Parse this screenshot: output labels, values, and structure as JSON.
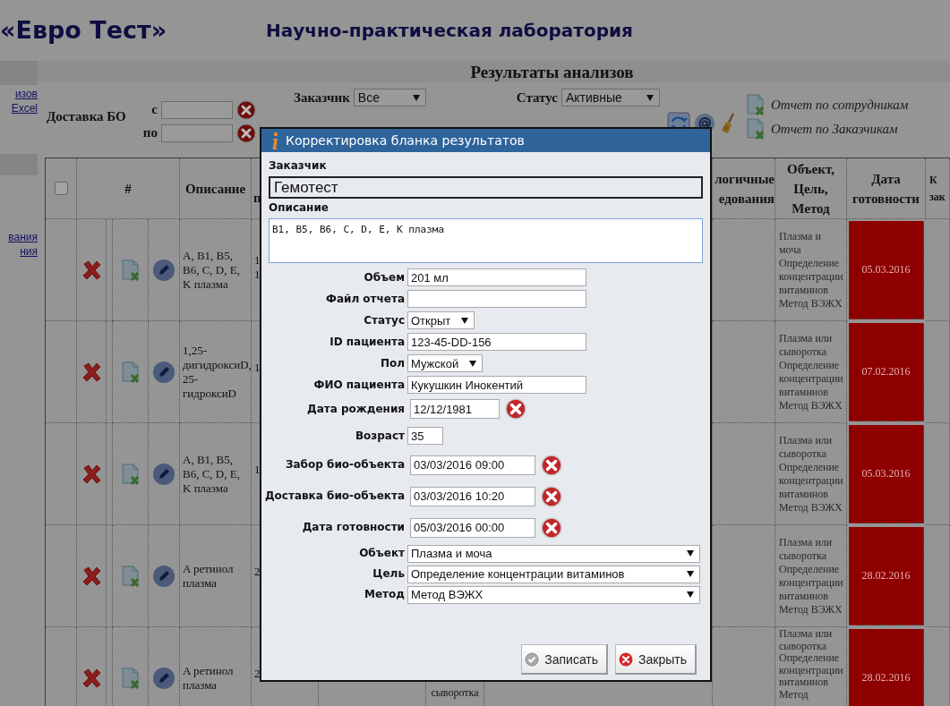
{
  "header": {
    "logo": "«Евро Тест»",
    "subtitle": "Научно-практическая лаборатория"
  },
  "sidebar": {
    "links_top": [
      "изов",
      "Excel"
    ],
    "links_bottom": [
      "вания",
      "ния"
    ]
  },
  "section_title": "Результаты анализов",
  "filters": {
    "delivery": {
      "label": "Доставка БО",
      "from_label": "с",
      "to_label": "по"
    },
    "customer": {
      "label": "Заказчик",
      "value": "Все"
    },
    "status": {
      "label": "Статус",
      "value": "Активные"
    },
    "reports": [
      "Отчет по сотрудникам",
      "Отчет по Заказчикам"
    ]
  },
  "table": {
    "select_all": {
      "checked": false
    },
    "columns": [
      "#",
      "Описание",
      "п",
      "логичные едования",
      "Объект, Цель, Метод",
      "Дата готовности",
      "К зак"
    ],
    "rows": [
      {
        "description": "A, B1, B5, B6, C, D, E, K плазма",
        "column_3": "1\n1",
        "column_4": "",
        "object_goal_method": "Плазма и моча Определение концентрации витаминов Метод ВЭЖХ",
        "ready_date": "05.03.2016",
        "overdue": true
      },
      {
        "description": "1,25-дигидроксиD, 25-гидроксиD",
        "column_3": "1",
        "column_4": "",
        "object_goal_method": "Плазма или сыворотка Определение концентрации витаминов Метод ВЭЖХ",
        "ready_date": "07.02.2016",
        "overdue": true
      },
      {
        "description": "A, B1, B5, B6, C, D, E, K плазма",
        "column_3": "1",
        "column_4": "",
        "object_goal_method": "Плазма или сыворотка Определение концентрации витаминов Метод ВЭЖХ",
        "ready_date": "05.03.2016",
        "overdue": true
      },
      {
        "description": "A ретинол плазма",
        "column_3": "2",
        "column_4": "",
        "object_goal_method": "Плазма или сыворотка Определение концентрации витаминов Метод ВЭЖХ",
        "ready_date": "28.02.2016",
        "overdue": true
      },
      {
        "description": "A ретинол плазма",
        "column_3": "2",
        "column_4": "сыворотка",
        "object_goal_method": "Плазма или сыворотка Определение концентрации витаминов Метод",
        "ready_date": "28.02.2016",
        "overdue": true
      }
    ]
  },
  "dialog": {
    "title": "Корректировка бланка результатов",
    "customer": {
      "label": "Заказчик",
      "value": "Гемотест"
    },
    "description": {
      "label": "Описание",
      "value": "B1, B5, B6, C, D, E, K плазма"
    },
    "fields": [
      {
        "label": "Объем",
        "kind": "text",
        "value": "201 мл"
      },
      {
        "label": "Файл отчета",
        "kind": "text"
      },
      {
        "label": "Статус",
        "kind": "select",
        "value": "Открыт"
      },
      {
        "label": "ID пациента",
        "kind": "text",
        "value": "123-45-DD-156"
      },
      {
        "label": "Пол",
        "kind": "select",
        "value": "Мужской"
      },
      {
        "label": "ФИО пациента",
        "kind": "text",
        "value": "Кукушкин Инокентий"
      },
      {
        "label": "Дата рождения",
        "kind": "date",
        "value": "12/12/1981"
      },
      {
        "label": "Возраст",
        "kind": "number",
        "value": "35"
      },
      {
        "label": "Забор био-объекта",
        "kind": "datetime",
        "value": "03/03/2016 09:00"
      },
      {
        "label": "Доставка био-объекта",
        "kind": "datetime",
        "value": "03/03/2016 10:20"
      },
      {
        "label": "Дата готовности",
        "kind": "datetime",
        "value": "05/03/2016 00:00"
      },
      {
        "label": "Объект",
        "kind": "wide_select",
        "value": "Плазма и моча"
      },
      {
        "label": "Цель",
        "kind": "wide_select",
        "value": "Определение концентрации витаминов"
      },
      {
        "label": "Метод",
        "kind": "wide_select",
        "value": "Метод ВЭЖХ"
      }
    ],
    "buttons": [
      {
        "label": "Записать",
        "kind": "save"
      },
      {
        "label": "Закрыть",
        "kind": "close"
      }
    ]
  }
}
